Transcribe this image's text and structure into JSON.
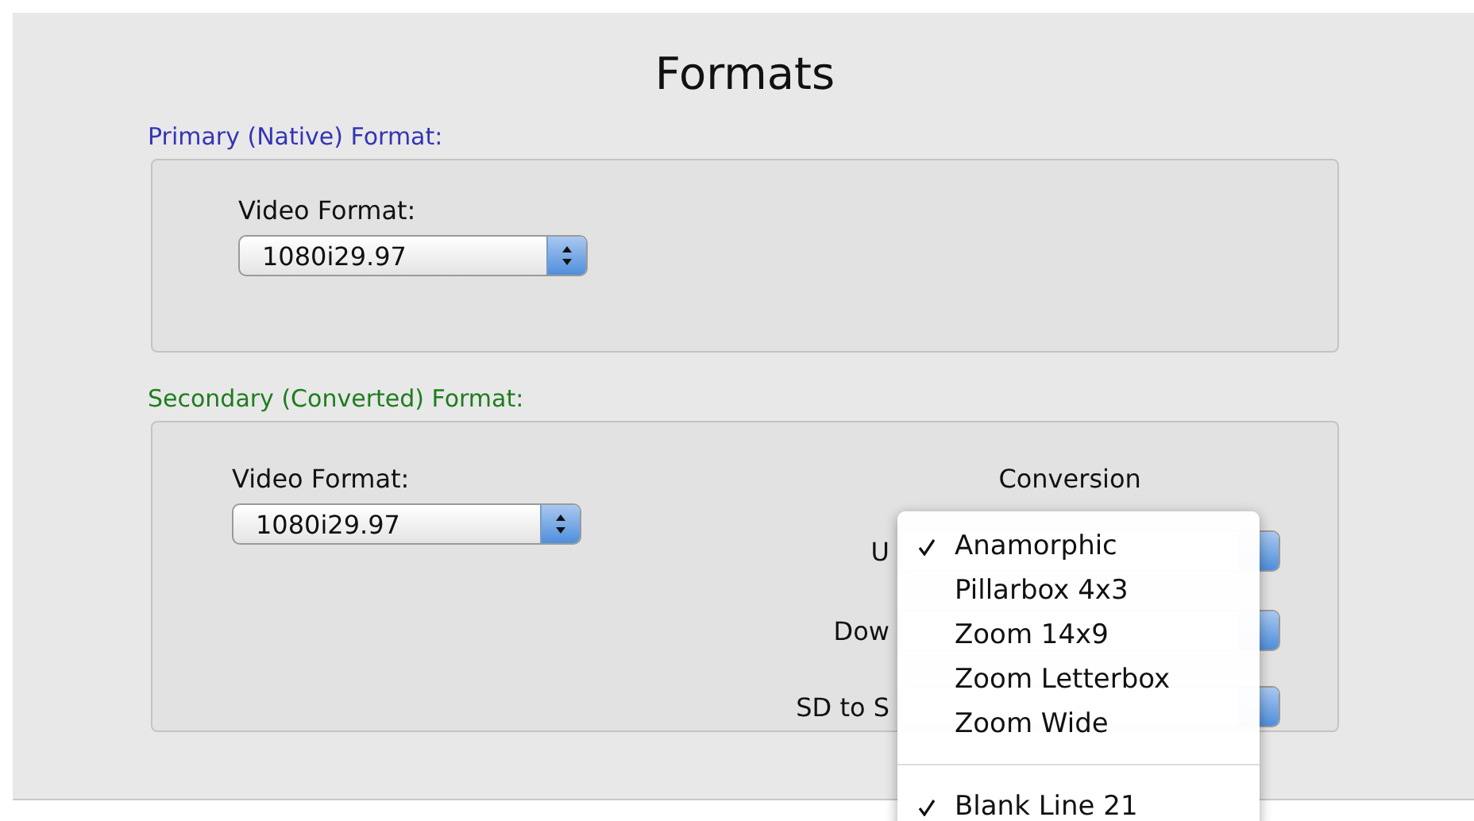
{
  "title": "Formats",
  "primary": {
    "label": "Primary (Native) Format:",
    "video_format_label": "Video Format:",
    "video_format": "1080i29.97"
  },
  "secondary": {
    "label": "Secondary (Converted) Format:",
    "video_format_label": "Video Format:",
    "video_format": "1080i29.97",
    "conversion_label": "Conversion",
    "rows": [
      {
        "label": "U"
      },
      {
        "label": "Dow"
      },
      {
        "label": "SD to S"
      }
    ]
  },
  "menu": {
    "items": [
      {
        "kind": "item",
        "label": "Anamorphic",
        "checked": true
      },
      {
        "kind": "item",
        "label": "Pillarbox 4x3",
        "checked": false
      },
      {
        "kind": "item",
        "label": "Zoom 14x9",
        "checked": false
      },
      {
        "kind": "item",
        "label": "Zoom Letterbox",
        "checked": false
      },
      {
        "kind": "item",
        "label": "Zoom Wide",
        "checked": false
      },
      {
        "kind": "separator"
      },
      {
        "kind": "item",
        "label": "Blank Line 21",
        "checked": true
      }
    ]
  }
}
